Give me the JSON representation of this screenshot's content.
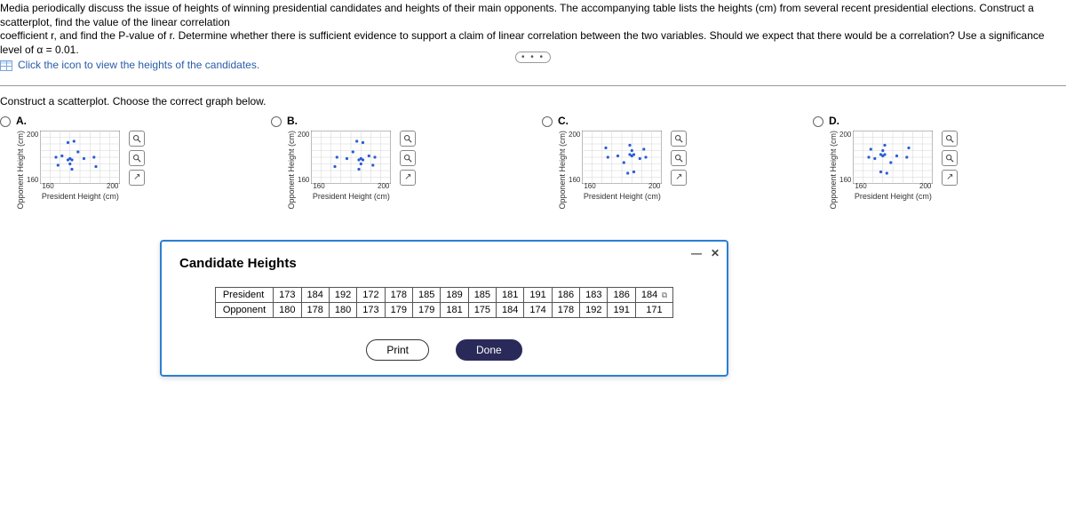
{
  "intro": {
    "line1": "Media periodically discuss the issue of heights of winning presidential candidates and heights of their main opponents. The accompanying table lists the heights (cm) from several recent presidential elections. Construct a scatterplot, find the value of the linear correlation",
    "line2": "coefficient r, and find the P-value of r. Determine whether there is sufficient evidence to support a claim of linear correlation between the two variables. Should we expect that there would be a correlation? Use a significance level of α = 0.01.",
    "link": "Click the icon to view the heights of the candidates."
  },
  "more_indicator": "• • •",
  "scatter_prompt": "Construct a scatterplot. Choose the correct graph below.",
  "choice_labels": {
    "a": "A.",
    "b": "B.",
    "c": "C.",
    "d": "D."
  },
  "axis": {
    "xmin": "160",
    "xmax": "200",
    "ymin": "160",
    "ymax": "200",
    "xlabel": "President Height (cm)",
    "ylabel": "Opponent Height (cm)"
  },
  "tool_names": {
    "zoom_in": "zoom-in",
    "zoom_out": "zoom-out",
    "open": "popout"
  },
  "modal": {
    "title": "Candidate Heights",
    "row1_label": "President",
    "row2_label": "Opponent",
    "buttons": {
      "print": "Print",
      "done": "Done"
    }
  },
  "chart_data": {
    "type": "scatter",
    "xlabel": "President Height (cm)",
    "ylabel": "Opponent Height (cm)",
    "xlim": [
      160,
      200
    ],
    "ylim": [
      160,
      200
    ],
    "president": [
      173,
      184,
      192,
      172,
      178,
      185,
      189,
      185,
      181,
      191,
      186,
      183,
      186,
      184
    ],
    "opponent": [
      180,
      178,
      180,
      173,
      179,
      179,
      181,
      175,
      184,
      174,
      178,
      192,
      191,
      171
    ],
    "options": [
      "A",
      "B",
      "C",
      "D"
    ],
    "note": "Each option is a miniature scatterplot of the same 14 data pairs with axes 160–200 on both axes; options differ by transformation (original data vs. reflected in x and/or y).",
    "transforms": {
      "A": {
        "x": "200-(p-160)",
        "y": "o"
      },
      "B": {
        "x": "p",
        "y": "o"
      },
      "C": {
        "x": "p",
        "y": "200-(o-160)"
      },
      "D": {
        "x": "200-(p-160)",
        "y": "200-(o-160)"
      }
    }
  }
}
